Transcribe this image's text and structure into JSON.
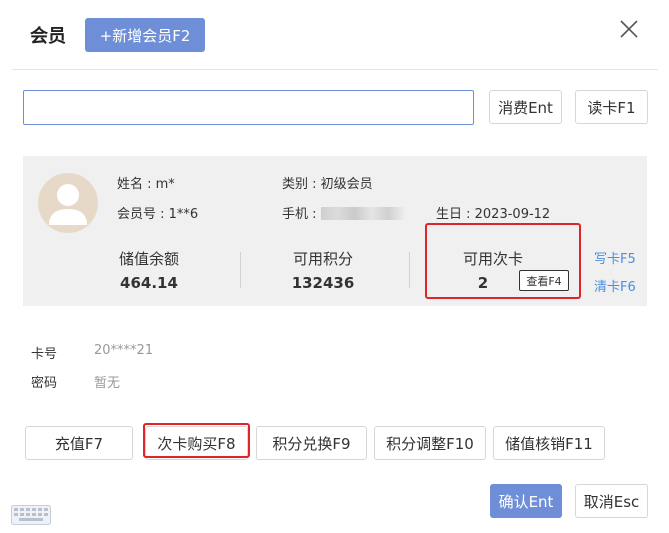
{
  "header": {
    "title": "会员",
    "add_button": "+新增会员F2"
  },
  "search": {
    "value": "",
    "placeholder": "",
    "consume_button": "消费Ent",
    "read_card_button": "读卡F1"
  },
  "member": {
    "name": "姓名 : m*",
    "category": "类别 : 初级会员",
    "member_no": "会员号 : 1**6",
    "phone_label": "手机 :",
    "birthday": "生日 : 2023-09-12"
  },
  "stats": [
    {
      "label": "储值余额",
      "value": "464.14"
    },
    {
      "label": "可用积分",
      "value": "132436"
    },
    {
      "label": "可用次卡",
      "value": "2"
    }
  ],
  "card_actions": {
    "check_button": "查看F4",
    "write_card": "写卡F5",
    "clear_card": "清卡F6"
  },
  "fields": [
    {
      "label": "卡号",
      "value": "20****21"
    },
    {
      "label": "密码",
      "value": "暂无"
    }
  ],
  "actions": [
    "充值F7",
    "次卡购买F8",
    "积分兑换F9",
    "积分调整F10",
    "储值核销F11"
  ],
  "footer": {
    "confirm": "确认Ent",
    "cancel": "取消Esc"
  },
  "colors": {
    "primary": "#6e8fd8",
    "highlight_box": "#e0242a",
    "link": "#4a8fe0"
  }
}
